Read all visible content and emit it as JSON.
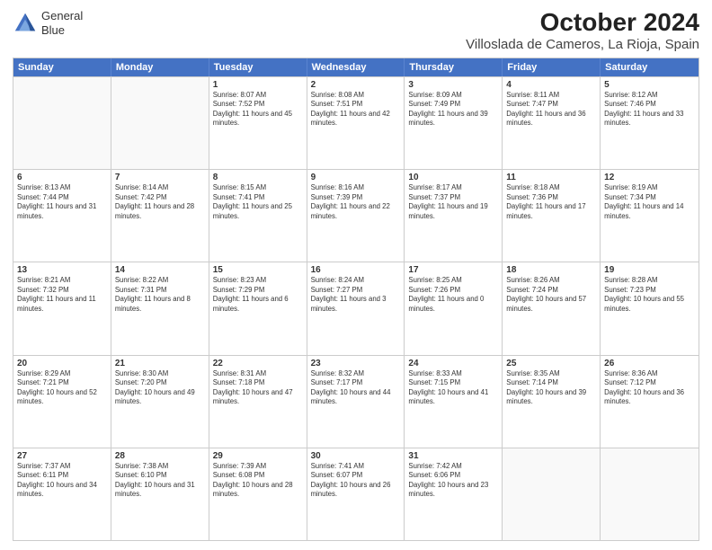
{
  "header": {
    "logo_line1": "General",
    "logo_line2": "Blue",
    "title": "October 2024",
    "subtitle": "Villoslada de Cameros, La Rioja, Spain"
  },
  "weekdays": [
    "Sunday",
    "Monday",
    "Tuesday",
    "Wednesday",
    "Thursday",
    "Friday",
    "Saturday"
  ],
  "weeks": [
    [
      {
        "day": "",
        "sunrise": "",
        "sunset": "",
        "daylight": "",
        "empty": true
      },
      {
        "day": "",
        "sunrise": "",
        "sunset": "",
        "daylight": "",
        "empty": true
      },
      {
        "day": "1",
        "sunrise": "Sunrise: 8:07 AM",
        "sunset": "Sunset: 7:52 PM",
        "daylight": "Daylight: 11 hours and 45 minutes.",
        "empty": false
      },
      {
        "day": "2",
        "sunrise": "Sunrise: 8:08 AM",
        "sunset": "Sunset: 7:51 PM",
        "daylight": "Daylight: 11 hours and 42 minutes.",
        "empty": false
      },
      {
        "day": "3",
        "sunrise": "Sunrise: 8:09 AM",
        "sunset": "Sunset: 7:49 PM",
        "daylight": "Daylight: 11 hours and 39 minutes.",
        "empty": false
      },
      {
        "day": "4",
        "sunrise": "Sunrise: 8:11 AM",
        "sunset": "Sunset: 7:47 PM",
        "daylight": "Daylight: 11 hours and 36 minutes.",
        "empty": false
      },
      {
        "day": "5",
        "sunrise": "Sunrise: 8:12 AM",
        "sunset": "Sunset: 7:46 PM",
        "daylight": "Daylight: 11 hours and 33 minutes.",
        "empty": false
      }
    ],
    [
      {
        "day": "6",
        "sunrise": "Sunrise: 8:13 AM",
        "sunset": "Sunset: 7:44 PM",
        "daylight": "Daylight: 11 hours and 31 minutes.",
        "empty": false
      },
      {
        "day": "7",
        "sunrise": "Sunrise: 8:14 AM",
        "sunset": "Sunset: 7:42 PM",
        "daylight": "Daylight: 11 hours and 28 minutes.",
        "empty": false
      },
      {
        "day": "8",
        "sunrise": "Sunrise: 8:15 AM",
        "sunset": "Sunset: 7:41 PM",
        "daylight": "Daylight: 11 hours and 25 minutes.",
        "empty": false
      },
      {
        "day": "9",
        "sunrise": "Sunrise: 8:16 AM",
        "sunset": "Sunset: 7:39 PM",
        "daylight": "Daylight: 11 hours and 22 minutes.",
        "empty": false
      },
      {
        "day": "10",
        "sunrise": "Sunrise: 8:17 AM",
        "sunset": "Sunset: 7:37 PM",
        "daylight": "Daylight: 11 hours and 19 minutes.",
        "empty": false
      },
      {
        "day": "11",
        "sunrise": "Sunrise: 8:18 AM",
        "sunset": "Sunset: 7:36 PM",
        "daylight": "Daylight: 11 hours and 17 minutes.",
        "empty": false
      },
      {
        "day": "12",
        "sunrise": "Sunrise: 8:19 AM",
        "sunset": "Sunset: 7:34 PM",
        "daylight": "Daylight: 11 hours and 14 minutes.",
        "empty": false
      }
    ],
    [
      {
        "day": "13",
        "sunrise": "Sunrise: 8:21 AM",
        "sunset": "Sunset: 7:32 PM",
        "daylight": "Daylight: 11 hours and 11 minutes.",
        "empty": false
      },
      {
        "day": "14",
        "sunrise": "Sunrise: 8:22 AM",
        "sunset": "Sunset: 7:31 PM",
        "daylight": "Daylight: 11 hours and 8 minutes.",
        "empty": false
      },
      {
        "day": "15",
        "sunrise": "Sunrise: 8:23 AM",
        "sunset": "Sunset: 7:29 PM",
        "daylight": "Daylight: 11 hours and 6 minutes.",
        "empty": false
      },
      {
        "day": "16",
        "sunrise": "Sunrise: 8:24 AM",
        "sunset": "Sunset: 7:27 PM",
        "daylight": "Daylight: 11 hours and 3 minutes.",
        "empty": false
      },
      {
        "day": "17",
        "sunrise": "Sunrise: 8:25 AM",
        "sunset": "Sunset: 7:26 PM",
        "daylight": "Daylight: 11 hours and 0 minutes.",
        "empty": false
      },
      {
        "day": "18",
        "sunrise": "Sunrise: 8:26 AM",
        "sunset": "Sunset: 7:24 PM",
        "daylight": "Daylight: 10 hours and 57 minutes.",
        "empty": false
      },
      {
        "day": "19",
        "sunrise": "Sunrise: 8:28 AM",
        "sunset": "Sunset: 7:23 PM",
        "daylight": "Daylight: 10 hours and 55 minutes.",
        "empty": false
      }
    ],
    [
      {
        "day": "20",
        "sunrise": "Sunrise: 8:29 AM",
        "sunset": "Sunset: 7:21 PM",
        "daylight": "Daylight: 10 hours and 52 minutes.",
        "empty": false
      },
      {
        "day": "21",
        "sunrise": "Sunrise: 8:30 AM",
        "sunset": "Sunset: 7:20 PM",
        "daylight": "Daylight: 10 hours and 49 minutes.",
        "empty": false
      },
      {
        "day": "22",
        "sunrise": "Sunrise: 8:31 AM",
        "sunset": "Sunset: 7:18 PM",
        "daylight": "Daylight: 10 hours and 47 minutes.",
        "empty": false
      },
      {
        "day": "23",
        "sunrise": "Sunrise: 8:32 AM",
        "sunset": "Sunset: 7:17 PM",
        "daylight": "Daylight: 10 hours and 44 minutes.",
        "empty": false
      },
      {
        "day": "24",
        "sunrise": "Sunrise: 8:33 AM",
        "sunset": "Sunset: 7:15 PM",
        "daylight": "Daylight: 10 hours and 41 minutes.",
        "empty": false
      },
      {
        "day": "25",
        "sunrise": "Sunrise: 8:35 AM",
        "sunset": "Sunset: 7:14 PM",
        "daylight": "Daylight: 10 hours and 39 minutes.",
        "empty": false
      },
      {
        "day": "26",
        "sunrise": "Sunrise: 8:36 AM",
        "sunset": "Sunset: 7:12 PM",
        "daylight": "Daylight: 10 hours and 36 minutes.",
        "empty": false
      }
    ],
    [
      {
        "day": "27",
        "sunrise": "Sunrise: 7:37 AM",
        "sunset": "Sunset: 6:11 PM",
        "daylight": "Daylight: 10 hours and 34 minutes.",
        "empty": false
      },
      {
        "day": "28",
        "sunrise": "Sunrise: 7:38 AM",
        "sunset": "Sunset: 6:10 PM",
        "daylight": "Daylight: 10 hours and 31 minutes.",
        "empty": false
      },
      {
        "day": "29",
        "sunrise": "Sunrise: 7:39 AM",
        "sunset": "Sunset: 6:08 PM",
        "daylight": "Daylight: 10 hours and 28 minutes.",
        "empty": false
      },
      {
        "day": "30",
        "sunrise": "Sunrise: 7:41 AM",
        "sunset": "Sunset: 6:07 PM",
        "daylight": "Daylight: 10 hours and 26 minutes.",
        "empty": false
      },
      {
        "day": "31",
        "sunrise": "Sunrise: 7:42 AM",
        "sunset": "Sunset: 6:06 PM",
        "daylight": "Daylight: 10 hours and 23 minutes.",
        "empty": false
      },
      {
        "day": "",
        "sunrise": "",
        "sunset": "",
        "daylight": "",
        "empty": true
      },
      {
        "day": "",
        "sunrise": "",
        "sunset": "",
        "daylight": "",
        "empty": true
      }
    ]
  ]
}
